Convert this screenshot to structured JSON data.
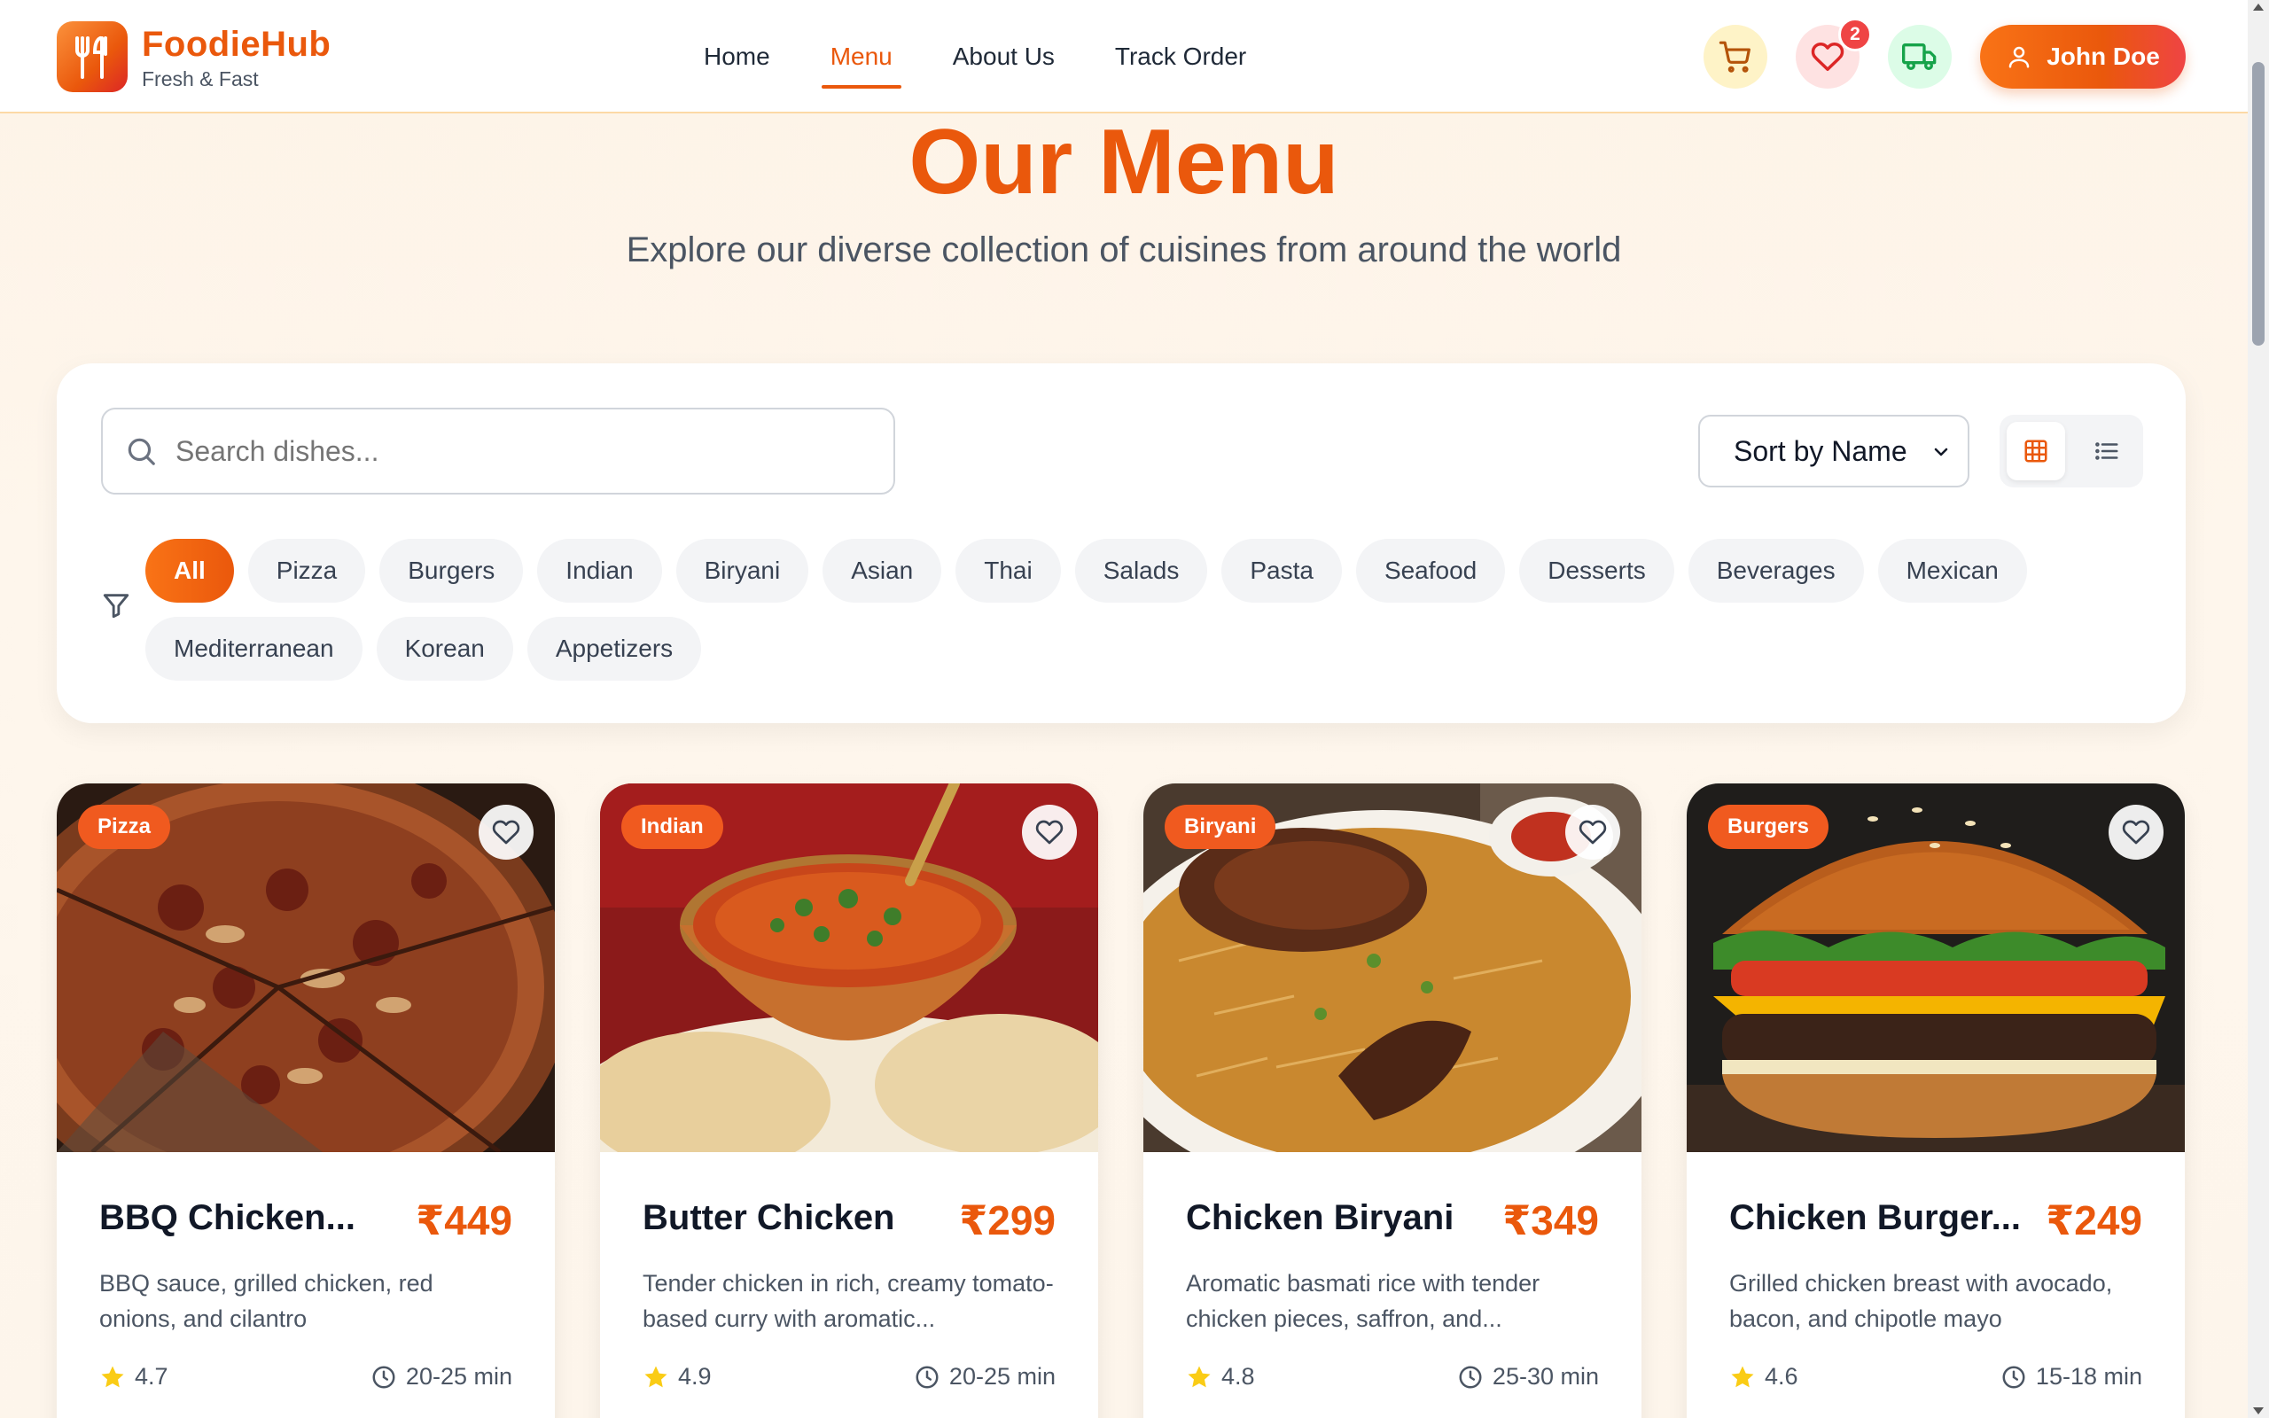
{
  "brand": {
    "name": "FoodieHub",
    "tagline": "Fresh & Fast"
  },
  "nav": [
    {
      "label": "Home",
      "active": false
    },
    {
      "label": "Menu",
      "active": true
    },
    {
      "label": "About Us",
      "active": false
    },
    {
      "label": "Track Order",
      "active": false
    }
  ],
  "header_actions": {
    "cart_icon": "cart-icon",
    "favorites_icon": "heart-icon",
    "favorites_count": "2",
    "track_icon": "truck-icon",
    "user_name": "John Doe"
  },
  "hero": {
    "title": "Our Menu",
    "subtitle": "Explore our diverse collection of cuisines from around the world"
  },
  "filters": {
    "search_placeholder": "Search dishes...",
    "sort_value": "Sort by Name",
    "view_mode": "grid",
    "categories": [
      {
        "label": "All",
        "active": true
      },
      {
        "label": "Pizza",
        "active": false
      },
      {
        "label": "Burgers",
        "active": false
      },
      {
        "label": "Indian",
        "active": false
      },
      {
        "label": "Biryani",
        "active": false
      },
      {
        "label": "Asian",
        "active": false
      },
      {
        "label": "Thai",
        "active": false
      },
      {
        "label": "Salads",
        "active": false
      },
      {
        "label": "Pasta",
        "active": false
      },
      {
        "label": "Seafood",
        "active": false
      },
      {
        "label": "Desserts",
        "active": false
      },
      {
        "label": "Beverages",
        "active": false
      },
      {
        "label": "Mexican",
        "active": false
      },
      {
        "label": "Mediterranean",
        "active": false
      },
      {
        "label": "Korean",
        "active": false
      },
      {
        "label": "Appetizers",
        "active": false
      }
    ]
  },
  "dishes": [
    {
      "category": "Pizza",
      "name": "BBQ Chicken...",
      "price": "₹449",
      "description": "BBQ sauce, grilled chicken, red onions, and cilantro",
      "rating": "4.7",
      "time": "20-25 min"
    },
    {
      "category": "Indian",
      "name": "Butter Chicken",
      "price": "₹299",
      "description": "Tender chicken in rich, creamy tomato-based curry with aromatic...",
      "rating": "4.9",
      "time": "20-25 min"
    },
    {
      "category": "Biryani",
      "name": "Chicken Biryani",
      "price": "₹349",
      "description": "Aromatic basmati rice with tender chicken pieces, saffron, and...",
      "rating": "4.8",
      "time": "25-30 min"
    },
    {
      "category": "Burgers",
      "name": "Chicken Burger...",
      "price": "₹249",
      "description": "Grilled chicken breast with avocado, bacon, and chipotle mayo",
      "rating": "4.6",
      "time": "15-18 min"
    }
  ],
  "colors": {
    "accent": "#ea580c",
    "accent_light": "#f97316",
    "badge": "#ef4444",
    "star": "#facc15"
  }
}
